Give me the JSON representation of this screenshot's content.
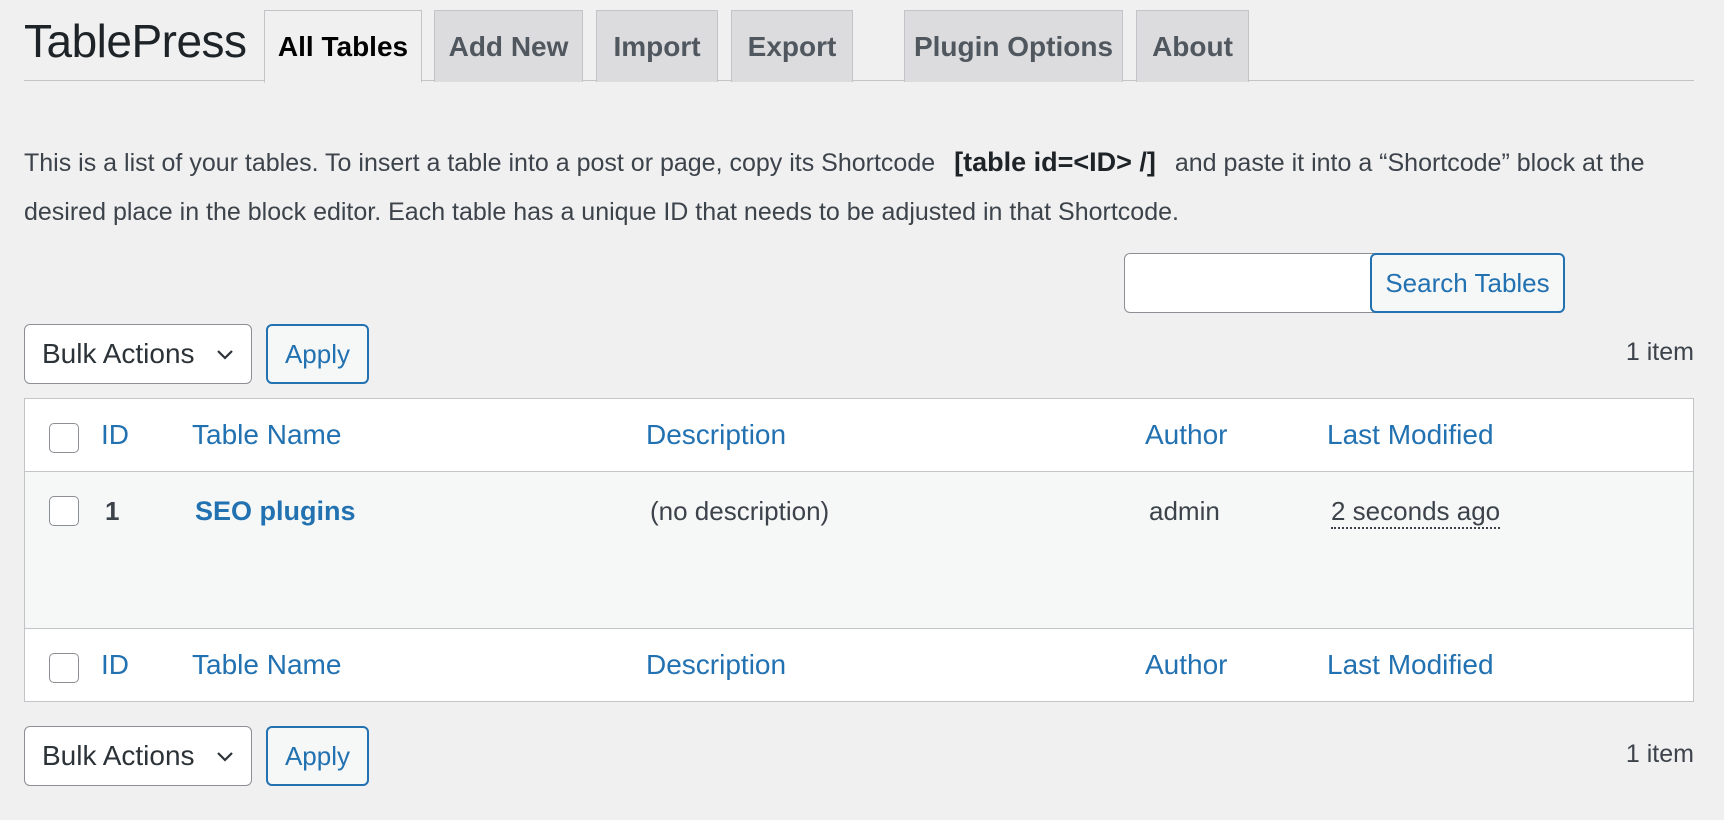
{
  "brand": "TablePress",
  "tabs": [
    {
      "label": "All Tables",
      "active": true
    },
    {
      "label": "Add New"
    },
    {
      "label": "Import"
    },
    {
      "label": "Export"
    },
    {
      "label": "Plugin Options"
    },
    {
      "label": "About"
    }
  ],
  "intro": {
    "before": "This is a list of your tables. To insert a table into a post or page, copy its Shortcode",
    "shortcode": "[table id=<ID> /]",
    "after": "and paste it into a “Shortcode” block at the desired place in the block editor. Each table has a unique ID that needs to be adjusted in that Shortcode."
  },
  "search": {
    "value": "",
    "button": "Search Tables"
  },
  "bulk": {
    "select": "Bulk Actions",
    "apply": "Apply",
    "count": "1 item"
  },
  "table": {
    "columns": [
      "ID",
      "Table Name",
      "Description",
      "Author",
      "Last Modified"
    ],
    "rows": [
      {
        "id": "1",
        "name": "SEO plugins",
        "description": "(no description)",
        "author": "admin",
        "modified": "2 seconds ago"
      }
    ]
  },
  "colors": {
    "accent": "#2271b1",
    "background": "#f0f0f1"
  }
}
